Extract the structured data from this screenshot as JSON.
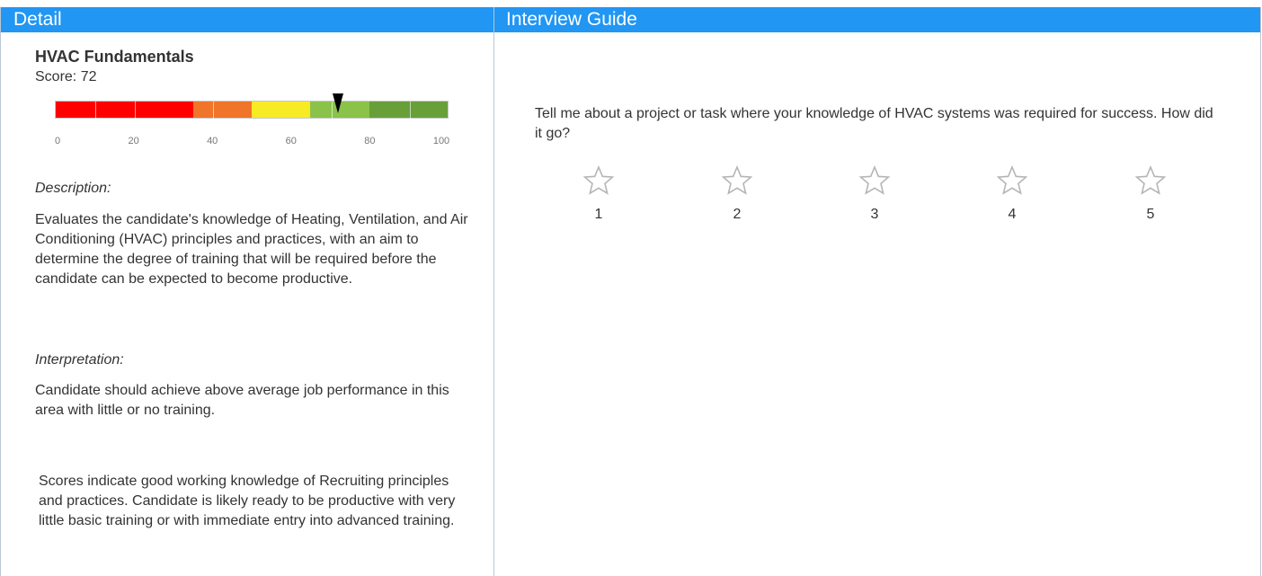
{
  "detail": {
    "header": "Detail",
    "skill_name": "HVAC Fundamentals",
    "score_label": "Score: 72",
    "score": 72,
    "scale": {
      "min": 0,
      "max": 100,
      "ticks": [
        "0",
        "20",
        "40",
        "60",
        "80",
        "100"
      ]
    },
    "bands": [
      {
        "from": 0,
        "to": 35,
        "color": "#ff0000"
      },
      {
        "from": 35,
        "to": 50,
        "color": "#f0742a"
      },
      {
        "from": 50,
        "to": 65,
        "color": "#f7eb25"
      },
      {
        "from": 65,
        "to": 80,
        "color": "#8bc34a"
      },
      {
        "from": 80,
        "to": 100,
        "color": "#689f38"
      }
    ],
    "description_label": "Description:",
    "description_text": "Evaluates the candidate's knowledge of Heating, Ventilation, and Air Conditioning (HVAC) principles and practices, with an aim to determine the degree of training that will be required before the candidate can be expected to become productive.",
    "interpretation_label": "Interpretation:",
    "interpretation_text": "Candidate should achieve above average job performance in this area with little or no training.",
    "extra_text": "Scores indicate good working knowledge of Recruiting principles and practices. Candidate is likely ready to be productive with very little basic training or with immediate entry into advanced training."
  },
  "interview": {
    "header": "Interview Guide",
    "question": "Tell me about a project or task where your knowledge of HVAC systems was required for success. How did it go?",
    "ratings": [
      "1",
      "2",
      "3",
      "4",
      "5"
    ]
  },
  "colors": {
    "header_bg": "#2196f3",
    "header_text": "#ffffff",
    "pointer": "#000000"
  }
}
